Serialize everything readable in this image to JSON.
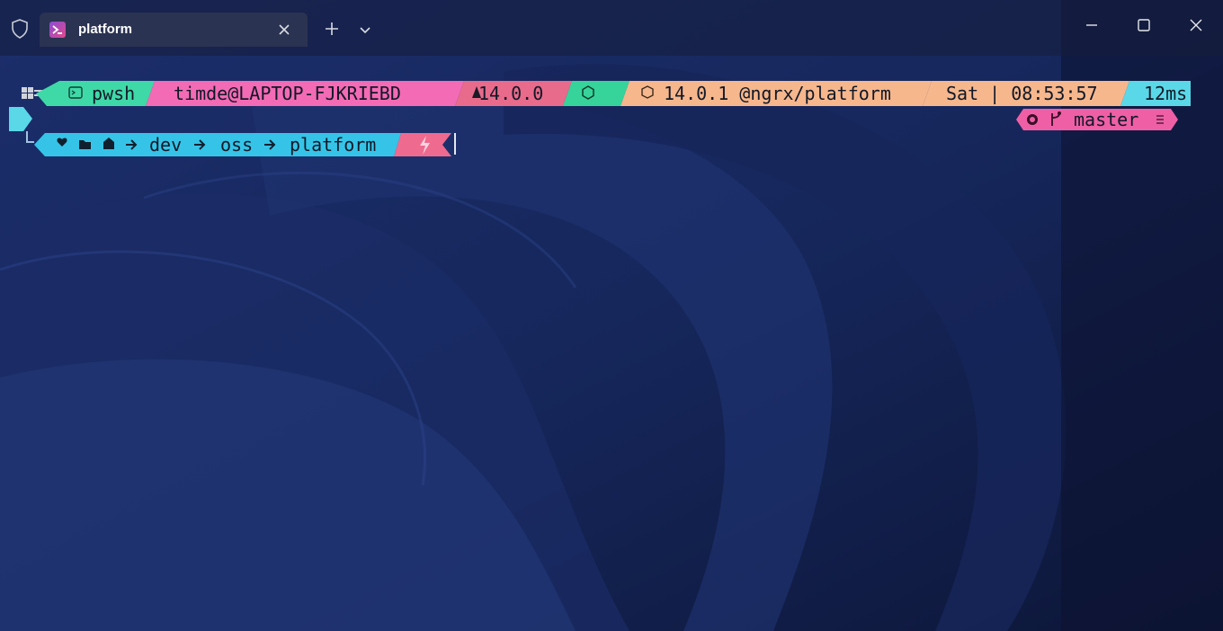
{
  "window": {
    "tab_title": "platform",
    "icons": {
      "shield": "shield-icon",
      "tab": "powershell-icon",
      "close": "close-icon",
      "new_tab": "plus-icon",
      "dropdown": "chevron-down-icon",
      "minimize": "minimize-icon",
      "maximize": "maximize-icon",
      "window_close": "close-icon"
    }
  },
  "prompt": {
    "shell": "pwsh",
    "user_host": "timde@LAPTOP-FJKRIEBD",
    "angular_version": "14.0.0",
    "package_info": "14.0.1 @ngrx/platform",
    "datetime": "Sat | 08:53:57",
    "duration": "12ms",
    "git_branch": "master",
    "path": [
      "dev",
      "oss",
      "platform"
    ]
  },
  "colors": {
    "shell_segment": "#3fd9a7",
    "user_segment": "#f36bb5",
    "angular_segment": "#e86b8c",
    "node_segment": "#36d49b",
    "package_segment": "#f6b78d",
    "time_segment": "#f6b78d",
    "duration_segment": "#5ad8e8",
    "git_segment": "#ef5fa6",
    "path_segment": "#35c4e8",
    "status_segment": "#ef6a8f"
  }
}
